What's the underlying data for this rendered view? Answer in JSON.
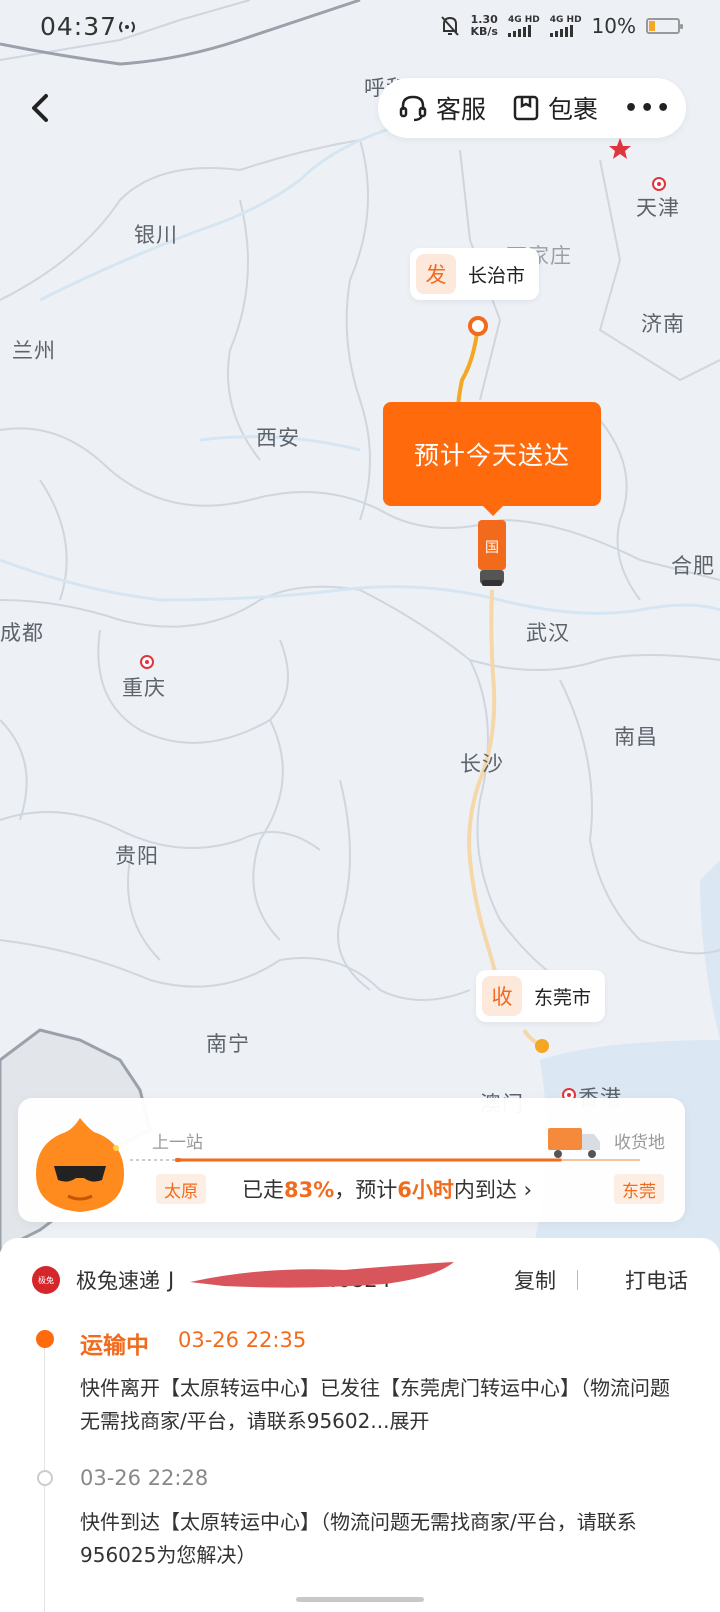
{
  "status_bar": {
    "time": "04:37",
    "speed_value": "1.30",
    "speed_unit": "KB/s",
    "sig1": "4G HD",
    "sig2": "4G HD",
    "battery": "10%"
  },
  "nav": {
    "service_label": "客服",
    "package_label": "包裹",
    "more_label": "•••"
  },
  "map": {
    "cities": {
      "huhe": "呼和",
      "tianjin": "天津",
      "yinchuan": "银川",
      "shijiazhuang": "石家庄",
      "lanzhou": "兰州",
      "jinan": "济南",
      "xian": "西安",
      "hefei": "合肥",
      "chengdu": "成都",
      "wuhan": "武汉",
      "chongqing": "重庆",
      "nanchang": "南昌",
      "changsha": "长沙",
      "guiyang": "贵阳",
      "nanning": "南宁",
      "macau": "澳门",
      "hongkong": "香港"
    },
    "origin": {
      "badge": "发",
      "city": "长治市"
    },
    "destination": {
      "badge": "收",
      "city": "东莞市"
    },
    "eta_bubble": "预计今天送达",
    "truck_label": "国"
  },
  "progress": {
    "prev_station_label": "上一站",
    "destination_label": "收货地",
    "prev_station": "太原",
    "destination": "东莞",
    "text_pre": "已走",
    "percent": "83%",
    "text_mid": "，预计",
    "hours": "6小时",
    "text_post": "内到达 ›",
    "progress_fraction": 0.83
  },
  "shipment": {
    "courier_logo": "极兔",
    "courier_name": "极兔速递",
    "tracking_visible": "J",
    "tracking_tail": "40824",
    "copy_label": "复制",
    "call_label": "打电话"
  },
  "events": [
    {
      "status": "运输中",
      "time": "03-26 22:35",
      "desc": "快件离开【太原转运中心】已发往【东莞虎门转运中心】（物流问题无需找商家/平台，请联系95602...",
      "expand": "展开"
    },
    {
      "time": "03-26 22:28",
      "desc": "快件到达【太原转运中心】（物流问题无需找商家/平台，请联系956025为您解决）"
    }
  ],
  "colors": {
    "accent": "#ff6a0d",
    "route": "#f5a623"
  }
}
